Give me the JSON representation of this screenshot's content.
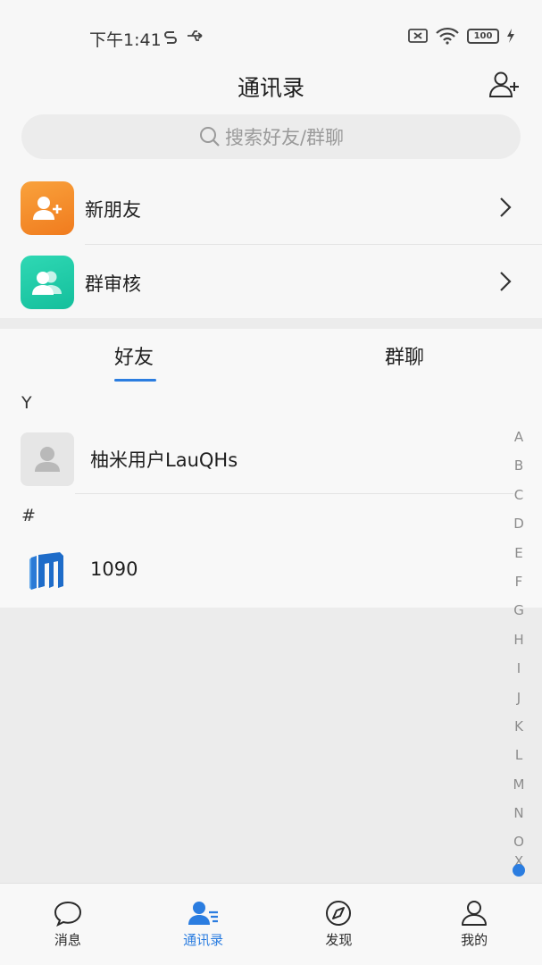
{
  "status_bar": {
    "time": "下午1:41",
    "battery": "100"
  },
  "header": {
    "title": "通讯录"
  },
  "search": {
    "placeholder": "搜索好友/群聊"
  },
  "menu": [
    {
      "label": "新朋友",
      "icon": "add-user-icon",
      "color": "#f58c2a"
    },
    {
      "label": "群审核",
      "icon": "group-icon",
      "color": "#1ec8a6"
    }
  ],
  "tabs": [
    {
      "label": "好友",
      "active": true
    },
    {
      "label": "群聊",
      "active": false
    }
  ],
  "contacts": [
    {
      "letter": "Y",
      "name": "柚米用户LauQHs"
    },
    {
      "letter": "#",
      "name": "1090"
    }
  ],
  "alpha_index": [
    "A",
    "B",
    "C",
    "D",
    "E",
    "F",
    "G",
    "H",
    "I",
    "J",
    "K",
    "L",
    "M",
    "N",
    "O",
    "X"
  ],
  "bottom_nav": [
    {
      "label": "消息",
      "active": false
    },
    {
      "label": "通讯录",
      "active": true
    },
    {
      "label": "发现",
      "active": false
    },
    {
      "label": "我的",
      "active": false
    }
  ],
  "colors": {
    "accent": "#2b7de0",
    "orange": "#f58c2a",
    "teal": "#1ec8a6"
  }
}
